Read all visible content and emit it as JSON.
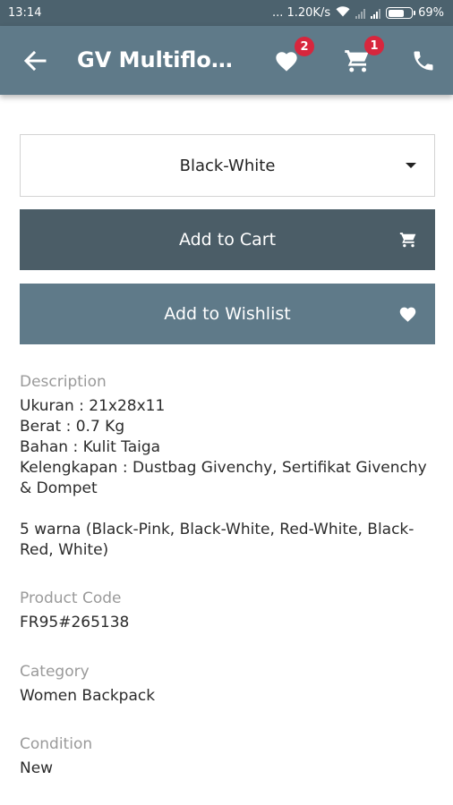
{
  "status_bar": {
    "time": "13:14",
    "network_speed": "... 1.20K/s",
    "battery_percent": "69%",
    "battery_level": 0.69
  },
  "app_bar": {
    "title": "GV Multiflow...",
    "wishlist_count": "2",
    "cart_count": "1",
    "icons": [
      "back-arrow-icon",
      "heart-icon",
      "cart-icon",
      "phone-icon"
    ]
  },
  "variant_select": {
    "selected": "Black-White"
  },
  "buttons": {
    "add_to_cart": "Add to Cart",
    "add_to_wishlist": "Add to Wishlist"
  },
  "description": {
    "label": "Description",
    "lines": [
      "Ukuran : 21x28x11",
      "Berat : 0.7 Kg",
      "Bahan : Kulit Taiga",
      "Kelengkapan : Dustbag Givenchy, Sertifikat Givenchy",
      "& Dompet",
      "",
      "5 warna (Black-Pink, Black-White, Red-White, Black-",
      "Red, White)"
    ]
  },
  "product_code": {
    "label": "Product Code",
    "value": "FR95#265138"
  },
  "category": {
    "label": "Category",
    "value": "Women Backpack"
  },
  "condition": {
    "label": "Condition",
    "value": "New"
  },
  "colors": {
    "status_bar": "#4c626e",
    "app_bar": "#5f7a89",
    "cart_button": "#4b5d67",
    "wishlist_button": "#5f7a89",
    "badge": "#d7263d"
  }
}
